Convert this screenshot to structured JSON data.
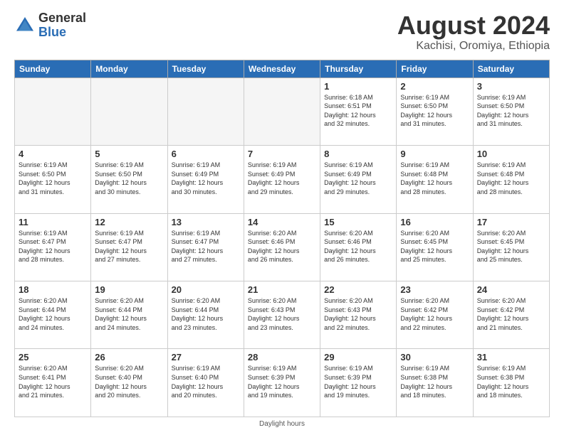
{
  "header": {
    "logo_line1": "General",
    "logo_line2": "Blue",
    "month": "August 2024",
    "location": "Kachisi, Oromiya, Ethiopia"
  },
  "days_of_week": [
    "Sunday",
    "Monday",
    "Tuesday",
    "Wednesday",
    "Thursday",
    "Friday",
    "Saturday"
  ],
  "footer": {
    "note": "Daylight hours"
  },
  "weeks": [
    [
      {
        "day": "",
        "info": ""
      },
      {
        "day": "",
        "info": ""
      },
      {
        "day": "",
        "info": ""
      },
      {
        "day": "",
        "info": ""
      },
      {
        "day": "1",
        "info": "Sunrise: 6:18 AM\nSunset: 6:51 PM\nDaylight: 12 hours\nand 32 minutes."
      },
      {
        "day": "2",
        "info": "Sunrise: 6:19 AM\nSunset: 6:50 PM\nDaylight: 12 hours\nand 31 minutes."
      },
      {
        "day": "3",
        "info": "Sunrise: 6:19 AM\nSunset: 6:50 PM\nDaylight: 12 hours\nand 31 minutes."
      }
    ],
    [
      {
        "day": "4",
        "info": "Sunrise: 6:19 AM\nSunset: 6:50 PM\nDaylight: 12 hours\nand 31 minutes."
      },
      {
        "day": "5",
        "info": "Sunrise: 6:19 AM\nSunset: 6:50 PM\nDaylight: 12 hours\nand 30 minutes."
      },
      {
        "day": "6",
        "info": "Sunrise: 6:19 AM\nSunset: 6:49 PM\nDaylight: 12 hours\nand 30 minutes."
      },
      {
        "day": "7",
        "info": "Sunrise: 6:19 AM\nSunset: 6:49 PM\nDaylight: 12 hours\nand 29 minutes."
      },
      {
        "day": "8",
        "info": "Sunrise: 6:19 AM\nSunset: 6:49 PM\nDaylight: 12 hours\nand 29 minutes."
      },
      {
        "day": "9",
        "info": "Sunrise: 6:19 AM\nSunset: 6:48 PM\nDaylight: 12 hours\nand 28 minutes."
      },
      {
        "day": "10",
        "info": "Sunrise: 6:19 AM\nSunset: 6:48 PM\nDaylight: 12 hours\nand 28 minutes."
      }
    ],
    [
      {
        "day": "11",
        "info": "Sunrise: 6:19 AM\nSunset: 6:47 PM\nDaylight: 12 hours\nand 28 minutes."
      },
      {
        "day": "12",
        "info": "Sunrise: 6:19 AM\nSunset: 6:47 PM\nDaylight: 12 hours\nand 27 minutes."
      },
      {
        "day": "13",
        "info": "Sunrise: 6:19 AM\nSunset: 6:47 PM\nDaylight: 12 hours\nand 27 minutes."
      },
      {
        "day": "14",
        "info": "Sunrise: 6:20 AM\nSunset: 6:46 PM\nDaylight: 12 hours\nand 26 minutes."
      },
      {
        "day": "15",
        "info": "Sunrise: 6:20 AM\nSunset: 6:46 PM\nDaylight: 12 hours\nand 26 minutes."
      },
      {
        "day": "16",
        "info": "Sunrise: 6:20 AM\nSunset: 6:45 PM\nDaylight: 12 hours\nand 25 minutes."
      },
      {
        "day": "17",
        "info": "Sunrise: 6:20 AM\nSunset: 6:45 PM\nDaylight: 12 hours\nand 25 minutes."
      }
    ],
    [
      {
        "day": "18",
        "info": "Sunrise: 6:20 AM\nSunset: 6:44 PM\nDaylight: 12 hours\nand 24 minutes."
      },
      {
        "day": "19",
        "info": "Sunrise: 6:20 AM\nSunset: 6:44 PM\nDaylight: 12 hours\nand 24 minutes."
      },
      {
        "day": "20",
        "info": "Sunrise: 6:20 AM\nSunset: 6:44 PM\nDaylight: 12 hours\nand 23 minutes."
      },
      {
        "day": "21",
        "info": "Sunrise: 6:20 AM\nSunset: 6:43 PM\nDaylight: 12 hours\nand 23 minutes."
      },
      {
        "day": "22",
        "info": "Sunrise: 6:20 AM\nSunset: 6:43 PM\nDaylight: 12 hours\nand 22 minutes."
      },
      {
        "day": "23",
        "info": "Sunrise: 6:20 AM\nSunset: 6:42 PM\nDaylight: 12 hours\nand 22 minutes."
      },
      {
        "day": "24",
        "info": "Sunrise: 6:20 AM\nSunset: 6:42 PM\nDaylight: 12 hours\nand 21 minutes."
      }
    ],
    [
      {
        "day": "25",
        "info": "Sunrise: 6:20 AM\nSunset: 6:41 PM\nDaylight: 12 hours\nand 21 minutes."
      },
      {
        "day": "26",
        "info": "Sunrise: 6:20 AM\nSunset: 6:40 PM\nDaylight: 12 hours\nand 20 minutes."
      },
      {
        "day": "27",
        "info": "Sunrise: 6:19 AM\nSunset: 6:40 PM\nDaylight: 12 hours\nand 20 minutes."
      },
      {
        "day": "28",
        "info": "Sunrise: 6:19 AM\nSunset: 6:39 PM\nDaylight: 12 hours\nand 19 minutes."
      },
      {
        "day": "29",
        "info": "Sunrise: 6:19 AM\nSunset: 6:39 PM\nDaylight: 12 hours\nand 19 minutes."
      },
      {
        "day": "30",
        "info": "Sunrise: 6:19 AM\nSunset: 6:38 PM\nDaylight: 12 hours\nand 18 minutes."
      },
      {
        "day": "31",
        "info": "Sunrise: 6:19 AM\nSunset: 6:38 PM\nDaylight: 12 hours\nand 18 minutes."
      }
    ]
  ]
}
